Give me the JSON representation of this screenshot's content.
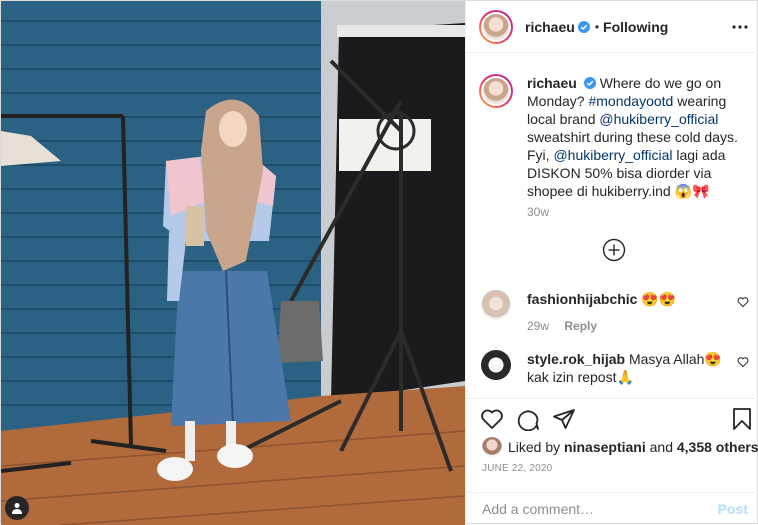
{
  "photo": {
    "alt_icon": "person-tag-icon"
  },
  "header": {
    "username": "richaeu",
    "separator": "•",
    "follow_state": "Following",
    "more_icon": "more-options-icon"
  },
  "caption": {
    "username": "richaeu",
    "parts": [
      "Where do we go on Monday? ",
      "#mondayootd",
      " wearing local brand ",
      "@hukiberry_official",
      " sweatshirt during these cold days. Fyi, ",
      "@hukiberry_official",
      " lagi ada DISKON 50% bisa diorder via shopee di hukiberry.ind 😱🎀"
    ],
    "time": "30w"
  },
  "comments": [
    {
      "username": "fashionhijabchic",
      "text": "😍😍",
      "time": "29w",
      "reply": "Reply"
    },
    {
      "username": "style.rok_hijab",
      "text": "Masya Allah😍 kak izin repost🙏",
      "time": "",
      "reply": ""
    }
  ],
  "likes": {
    "prefix": "Liked by ",
    "user": "ninaseptiani",
    "middle": " and ",
    "count": "4,358 others"
  },
  "date": "JUNE 22, 2020",
  "composer": {
    "placeholder": "Add a comment…",
    "post_label": "Post"
  },
  "colors": {
    "link": "#00376b",
    "muted": "#8e8e8e",
    "verified": "#3897f0",
    "post_disabled": "#b2dffc",
    "avatar_ring": [
      "#f9b33b",
      "#e1306c",
      "#b32c9c"
    ]
  }
}
